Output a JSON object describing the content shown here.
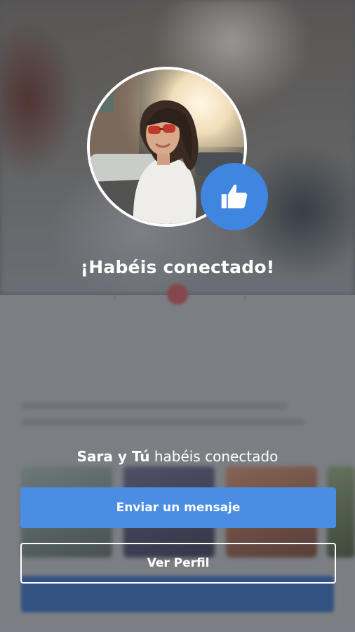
{
  "match": {
    "headline": "¡Habéis conectado!",
    "subtitle_names": "Sara y Tú",
    "subtitle_rest": "habéis conectado",
    "primary_button": "Enviar un mensaje",
    "secondary_button": "Ver Perfil"
  },
  "icons": {
    "badge": "thumbs-up-icon"
  },
  "colors": {
    "accent": "#4a8de3",
    "badge": "#3f86e0",
    "text": "#ffffff"
  }
}
